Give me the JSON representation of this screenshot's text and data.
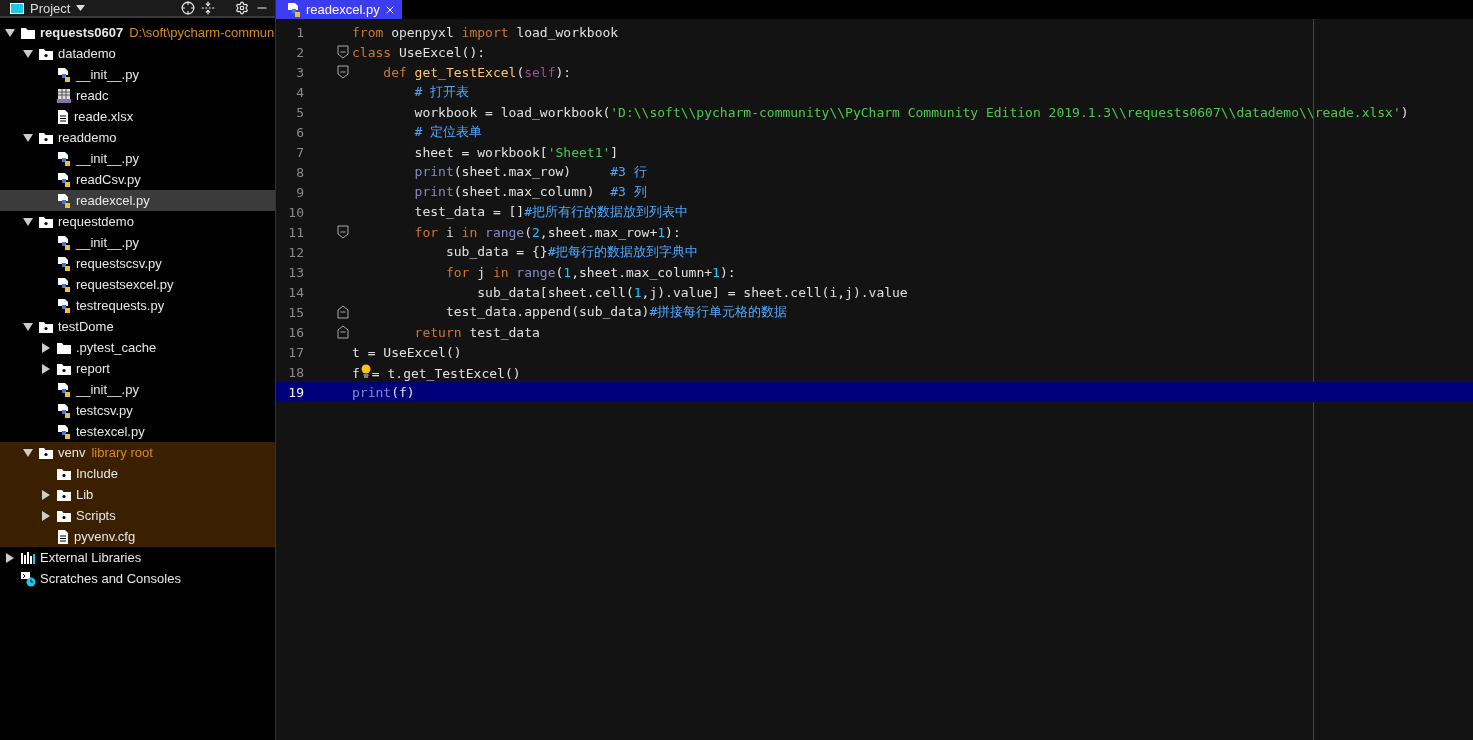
{
  "sidebar": {
    "title": "Project",
    "tree": [
      {
        "label": "requests0607",
        "hint": "D:\\soft\\pycharm-commun",
        "kind": "folder",
        "expanded": true,
        "selected": false,
        "library": false,
        "bold": true,
        "children": [
          {
            "label": "datademo",
            "kind": "package",
            "expanded": true,
            "selected": false,
            "library": false,
            "children": [
              {
                "label": "__init__.py",
                "kind": "python",
                "selected": false,
                "library": false
              },
              {
                "label": "readc",
                "kind": "csv",
                "selected": false,
                "library": false
              },
              {
                "label": "reade.xlsx",
                "kind": "text",
                "selected": false,
                "library": false
              }
            ]
          },
          {
            "label": "readdemo",
            "kind": "package",
            "expanded": true,
            "selected": false,
            "library": false,
            "children": [
              {
                "label": "__init__.py",
                "kind": "python",
                "selected": false,
                "library": false
              },
              {
                "label": "readCsv.py",
                "kind": "python",
                "selected": false,
                "library": false
              },
              {
                "label": "readexcel.py",
                "kind": "python",
                "selected": true,
                "library": false
              }
            ]
          },
          {
            "label": "requestdemo",
            "kind": "package",
            "expanded": true,
            "selected": false,
            "library": false,
            "children": [
              {
                "label": "__init__.py",
                "kind": "python",
                "selected": false,
                "library": false
              },
              {
                "label": "requestscsv.py",
                "kind": "python",
                "selected": false,
                "library": false
              },
              {
                "label": "requestsexcel.py",
                "kind": "python",
                "selected": false,
                "library": false
              },
              {
                "label": "testrequests.py",
                "kind": "python",
                "selected": false,
                "library": false
              }
            ]
          },
          {
            "label": "testDome",
            "kind": "package",
            "expanded": true,
            "selected": false,
            "library": false,
            "children": [
              {
                "label": ".pytest_cache",
                "kind": "folder",
                "expanded": false,
                "selected": false,
                "library": false
              },
              {
                "label": "report",
                "kind": "package",
                "expanded": false,
                "selected": false,
                "library": false
              },
              {
                "label": "__init__.py",
                "kind": "python",
                "selected": false,
                "library": false
              },
              {
                "label": "testcsv.py",
                "kind": "python",
                "selected": false,
                "library": false
              },
              {
                "label": "testexcel.py",
                "kind": "python",
                "selected": false,
                "library": false
              }
            ]
          },
          {
            "label": "venv",
            "hint": "library root",
            "kind": "package",
            "expanded": true,
            "selected": false,
            "library": true,
            "children": [
              {
                "label": "Include",
                "kind": "package",
                "selected": false,
                "library": true
              },
              {
                "label": "Lib",
                "kind": "package",
                "expanded": false,
                "selected": false,
                "library": true
              },
              {
                "label": "Scripts",
                "kind": "package",
                "expanded": false,
                "selected": false,
                "library": true
              },
              {
                "label": "pyvenv.cfg",
                "kind": "text",
                "selected": false,
                "library": true
              }
            ]
          }
        ]
      },
      {
        "label": "External Libraries",
        "kind": "libraries",
        "expanded": false,
        "selected": false,
        "library": false
      },
      {
        "label": "Scratches and Consoles",
        "kind": "scratches",
        "selected": false,
        "library": false
      }
    ]
  },
  "editor": {
    "tabs": [
      {
        "label": "readexcel.py",
        "selected": true
      }
    ],
    "lines": [
      {
        "number": "1",
        "current": false,
        "kind": "plain",
        "tokens": [
          {
            "kind": "kw",
            "text": "from"
          },
          {
            "kind": "id",
            "text": " openpyxl "
          },
          {
            "kind": "kw",
            "text": "import"
          },
          {
            "kind": "id",
            "text": " load_workbook"
          }
        ]
      },
      {
        "number": "2",
        "current": false,
        "kind": "fold_start",
        "tokens": [
          {
            "kind": "kw",
            "text": "class"
          },
          {
            "kind": "id",
            "text": " UseExcel():"
          }
        ]
      },
      {
        "number": "3",
        "current": false,
        "kind": "fold_start",
        "tokens": [
          {
            "kind": "kw",
            "text": "    def"
          },
          {
            "kind": "fn",
            "text": " get_TestExcel"
          },
          {
            "kind": "id",
            "text": "("
          },
          {
            "kind": "self",
            "text": "self"
          },
          {
            "kind": "id",
            "text": "):"
          }
        ]
      },
      {
        "number": "4",
        "current": false,
        "kind": "plain",
        "tokens": [
          {
            "kind": "comment",
            "text": "        # 打开表"
          }
        ]
      },
      {
        "number": "5",
        "current": false,
        "kind": "plain",
        "tokens": [
          {
            "kind": "id",
            "text": "        workbook = load_workbook("
          },
          {
            "kind": "str",
            "text": "'D:\\\\soft\\\\pycharm-community\\\\PyCharm Community Edition 2019.1.3\\\\requests0607\\\\datademo\\\\reade.xlsx'"
          },
          {
            "kind": "id",
            "text": ")"
          }
        ]
      },
      {
        "number": "6",
        "current": false,
        "kind": "plain",
        "tokens": [
          {
            "kind": "comment",
            "text": "        # 定位表单"
          }
        ]
      },
      {
        "number": "7",
        "current": false,
        "kind": "plain",
        "tokens": [
          {
            "kind": "id",
            "text": "        sheet = workbook["
          },
          {
            "kind": "str",
            "text": "'Sheet1'"
          },
          {
            "kind": "id",
            "text": "]"
          }
        ]
      },
      {
        "number": "8",
        "current": false,
        "kind": "plain",
        "tokens": [
          {
            "kind": "builtin",
            "text": "        print"
          },
          {
            "kind": "id",
            "text": "(sheet.max_row)     "
          },
          {
            "kind": "comment",
            "text": "#3 行"
          }
        ]
      },
      {
        "number": "9",
        "current": false,
        "kind": "plain",
        "tokens": [
          {
            "kind": "builtin",
            "text": "        print"
          },
          {
            "kind": "id",
            "text": "(sheet.max_column)  "
          },
          {
            "kind": "comment",
            "text": "#3 列"
          }
        ]
      },
      {
        "number": "10",
        "current": false,
        "kind": "plain",
        "tokens": [
          {
            "kind": "id",
            "text": "        test_data = []"
          },
          {
            "kind": "comment",
            "text": "#把所有行的数据放到列表中"
          }
        ]
      },
      {
        "number": "11",
        "current": false,
        "kind": "fold_start",
        "tokens": [
          {
            "kind": "kw",
            "text": "        for"
          },
          {
            "kind": "id",
            "text": " i "
          },
          {
            "kind": "kw",
            "text": "in"
          },
          {
            "kind": "builtin",
            "text": " range"
          },
          {
            "kind": "id",
            "text": "("
          },
          {
            "kind": "num",
            "text": "2"
          },
          {
            "kind": "id",
            "text": ",sheet.max_row+"
          },
          {
            "kind": "num",
            "text": "1"
          },
          {
            "kind": "id",
            "text": "):"
          }
        ]
      },
      {
        "number": "12",
        "current": false,
        "kind": "plain",
        "tokens": [
          {
            "kind": "id",
            "text": "            sub_data = {}"
          },
          {
            "kind": "comment",
            "text": "#把每行的数据放到字典中"
          }
        ]
      },
      {
        "number": "13",
        "current": false,
        "kind": "plain",
        "tokens": [
          {
            "kind": "kw",
            "text": "            for"
          },
          {
            "kind": "id",
            "text": " j "
          },
          {
            "kind": "kw",
            "text": "in"
          },
          {
            "kind": "builtin",
            "text": " range"
          },
          {
            "kind": "id",
            "text": "("
          },
          {
            "kind": "num",
            "text": "1"
          },
          {
            "kind": "id",
            "text": ",sheet.max_column+"
          },
          {
            "kind": "num",
            "text": "1"
          },
          {
            "kind": "id",
            "text": "):"
          }
        ]
      },
      {
        "number": "14",
        "current": false,
        "kind": "plain",
        "tokens": [
          {
            "kind": "id",
            "text": "                sub_data[sheet.cell("
          },
          {
            "kind": "num",
            "text": "1"
          },
          {
            "kind": "id",
            "text": ",j).value] = sheet.cell(i,j).value"
          }
        ]
      },
      {
        "number": "15",
        "current": false,
        "kind": "fold_end",
        "tokens": [
          {
            "kind": "id",
            "text": "            test_data.append(sub_data)"
          },
          {
            "kind": "comment",
            "text": "#拼接每行单元格的数据"
          }
        ]
      },
      {
        "number": "16",
        "current": false,
        "kind": "fold_end",
        "tokens": [
          {
            "kind": "kw",
            "text": "        return"
          },
          {
            "kind": "id",
            "text": " test_data"
          }
        ]
      },
      {
        "number": "17",
        "current": false,
        "kind": "plain",
        "tokens": [
          {
            "kind": "id",
            "text": "t = UseExcel()"
          }
        ]
      },
      {
        "number": "18",
        "current": false,
        "kind": "plain",
        "tokens": [
          {
            "kind": "id",
            "text": "f"
          },
          {
            "kind": "bulb"
          },
          {
            "kind": "id",
            "text": "= t.get_TestExcel()"
          }
        ]
      },
      {
        "number": "19",
        "current": true,
        "kind": "plain",
        "tokens": [
          {
            "kind": "builtin",
            "text": "print"
          },
          {
            "kind": "id",
            "text": "(f)"
          }
        ]
      }
    ]
  }
}
